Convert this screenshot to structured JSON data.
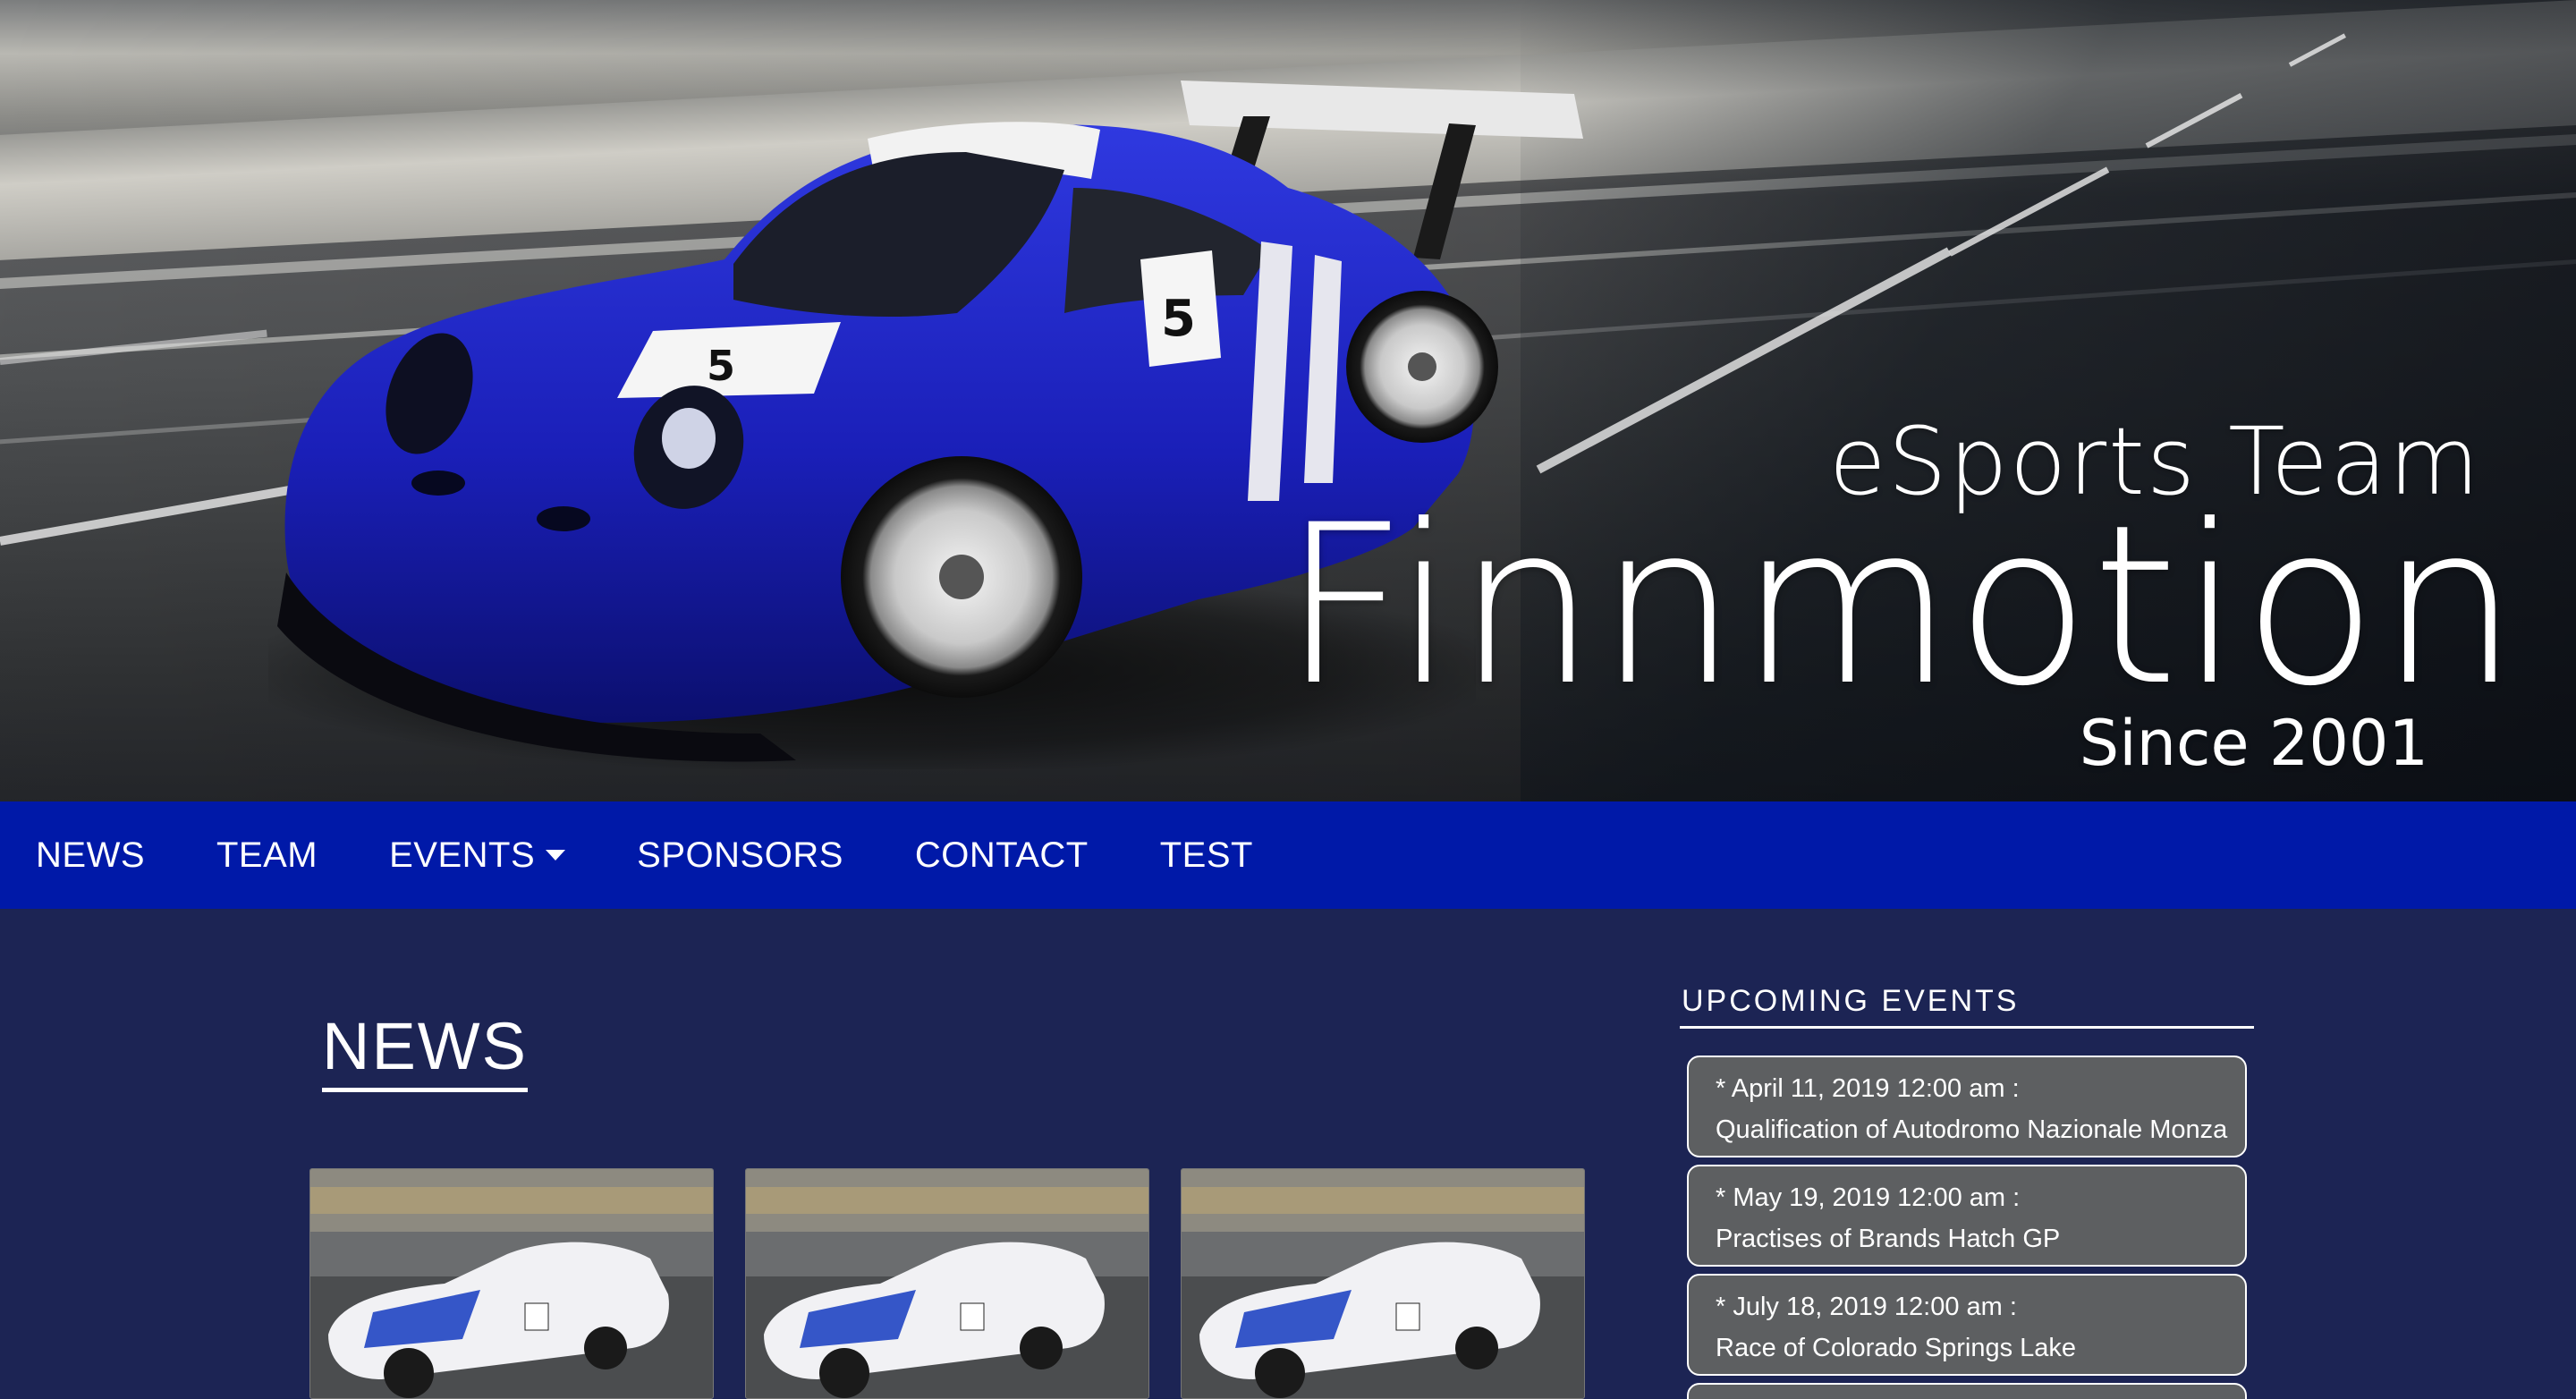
{
  "hero": {
    "subtitle": "eSports Team",
    "title": "Finnmotion",
    "since": "Since 2001",
    "car_color": "#1a1fb8"
  },
  "nav": {
    "items": [
      {
        "label": "NEWS"
      },
      {
        "label": "TEAM"
      },
      {
        "label": "EVENTS",
        "dropdown": true
      },
      {
        "label": "SPONSORS"
      },
      {
        "label": "CONTACT"
      },
      {
        "label": "TEST"
      }
    ],
    "background": "#0019a8"
  },
  "news": {
    "heading": "NEWS",
    "cards": [
      {
        "image": "race-car-thumbnail"
      },
      {
        "image": "race-car-thumbnail"
      },
      {
        "image": "race-car-thumbnail"
      }
    ]
  },
  "events": {
    "title": "UPCOMING EVENTS",
    "items": [
      {
        "date": "* April 11, 2019 12:00 am :",
        "name": "Qualification of Autodromo Nazionale Monza"
      },
      {
        "date": "* May 19, 2019 12:00 am :",
        "name": "Practises of Brands Hatch GP"
      },
      {
        "date": "* July 18, 2019 12:00 am :",
        "name": "Race of Colorado Springs Lake"
      }
    ]
  },
  "colors": {
    "page_background": "#1c2454",
    "event_card": "#5d5f61"
  }
}
